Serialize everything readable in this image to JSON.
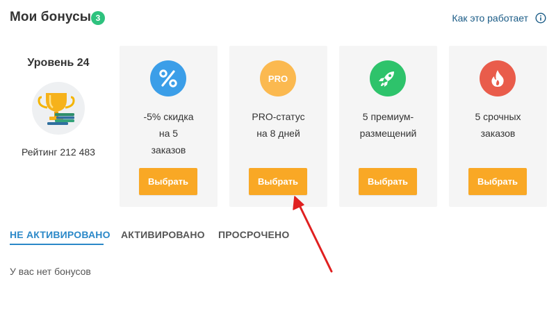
{
  "header": {
    "title": "Мои бонусы",
    "badge_count": "3",
    "how_link": "Как это работает",
    "info_icon": "info-icon"
  },
  "level": {
    "title": "Уровень 24",
    "icon": "trophy-icon",
    "rating": "Рейтинг 212 483"
  },
  "cards": [
    {
      "icon": "percent-icon",
      "color": "#3b9ee8",
      "lines": [
        "-5% скидка",
        "на 5",
        "заказов"
      ],
      "button": "Выбрать"
    },
    {
      "icon": "pro-icon",
      "icon_text": "PRO",
      "color": "#fbb950",
      "lines": [
        "PRO-статус",
        "на 8 дней"
      ],
      "button": "Выбрать"
    },
    {
      "icon": "rocket-icon",
      "color": "#2ec36b",
      "lines": [
        "5 премиум-",
        "размещений"
      ],
      "button": "Выбрать"
    },
    {
      "icon": "fire-icon",
      "color": "#e95c4b",
      "lines": [
        "5 срочных",
        "заказов"
      ],
      "button": "Выбрать"
    }
  ],
  "tabs": [
    {
      "label": "НЕ АКТИВИРОВАНО",
      "active": true
    },
    {
      "label": "АКТИВИРОВАНО",
      "active": false
    },
    {
      "label": "ПРОСРОЧЕНО",
      "active": false
    }
  ],
  "empty_message": "У вас нет бонусов",
  "colors": {
    "accent_blue": "#2a88c8",
    "button_orange": "#f9a825",
    "badge_green": "#2ec27e",
    "link_blue": "#1a5b86",
    "arrow_red": "#e02020"
  }
}
